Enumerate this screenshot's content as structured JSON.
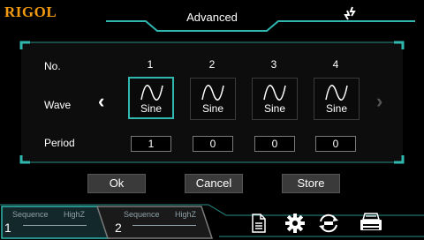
{
  "header": {
    "brand": "RIGOL",
    "title": "Advanced",
    "link_icon": "link-swap-icon"
  },
  "table": {
    "row_labels": {
      "no": "No.",
      "wave": "Wave",
      "period": "Period"
    },
    "columns": [
      {
        "no": "1",
        "wave": "Sine",
        "period": "1",
        "selected": true
      },
      {
        "no": "2",
        "wave": "Sine",
        "period": "0",
        "selected": false
      },
      {
        "no": "3",
        "wave": "Sine",
        "period": "0",
        "selected": false
      },
      {
        "no": "4",
        "wave": "Sine",
        "period": "0",
        "selected": false
      }
    ],
    "prev_icon": "chevron-left-icon",
    "next_icon": "chevron-right-icon"
  },
  "buttons": {
    "ok": "Ok",
    "cancel": "Cancel",
    "store": "Store"
  },
  "channels": [
    {
      "number": "1",
      "mode": "Sequence",
      "impedance": "HighZ",
      "active": true
    },
    {
      "number": "2",
      "mode": "Sequence",
      "impedance": "HighZ",
      "active": false
    }
  ],
  "toolbar_icons": [
    "document-icon",
    "gear-icon",
    "sync-icon",
    "printer-icon"
  ],
  "colors": {
    "accent": "#2fb7b0",
    "brand": "#f29a10",
    "panel": "#0d0d0d",
    "button": "#3a3a3a"
  }
}
